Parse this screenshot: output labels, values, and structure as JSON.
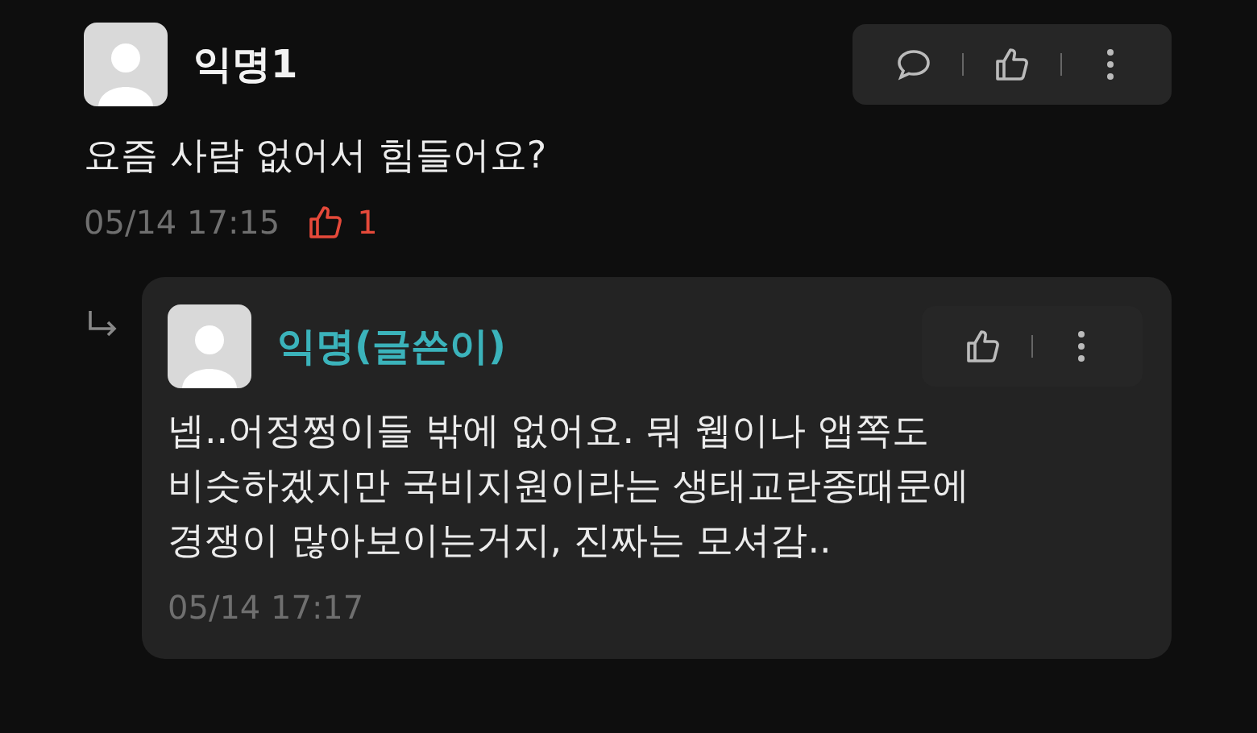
{
  "comments": [
    {
      "author": "익명1",
      "is_writer": false,
      "text": "요즘 사람 없어서 힘들어요?",
      "time": "05/14 17:15",
      "likes": "1",
      "actions": [
        {
          "kind": "comment"
        },
        {
          "kind": "like"
        },
        {
          "kind": "more"
        }
      ],
      "replies": [
        {
          "author": "익명(글쓴이)",
          "is_writer": true,
          "text": "넵..어정쩡이들 밖에 없어요. 뭐 웹이나 앱쪽도\n비슷하겠지만 국비지원이라는 생태교란종때문에\n경쟁이 많아보이는거지, 진짜는 모셔감..",
          "time": "05/14 17:17",
          "actions": [
            {
              "kind": "like"
            },
            {
              "kind": "more"
            }
          ]
        }
      ]
    }
  ]
}
